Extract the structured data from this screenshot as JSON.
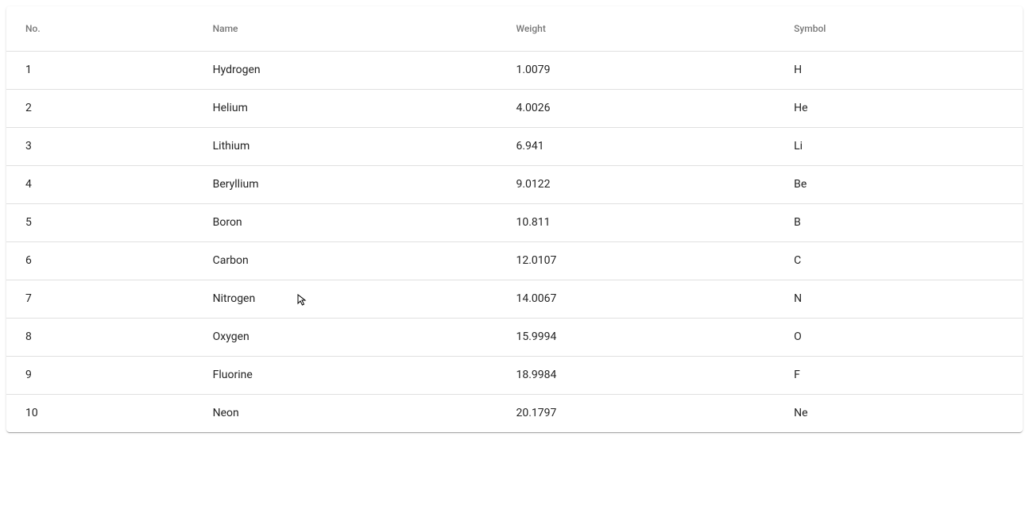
{
  "columns": {
    "no": "No.",
    "name": "Name",
    "weight": "Weight",
    "symbol": "Symbol"
  },
  "rows": [
    {
      "no": "1",
      "name": "Hydrogen",
      "weight": "1.0079",
      "symbol": "H"
    },
    {
      "no": "2",
      "name": "Helium",
      "weight": "4.0026",
      "symbol": "He"
    },
    {
      "no": "3",
      "name": "Lithium",
      "weight": "6.941",
      "symbol": "Li"
    },
    {
      "no": "4",
      "name": "Beryllium",
      "weight": "9.0122",
      "symbol": "Be"
    },
    {
      "no": "5",
      "name": "Boron",
      "weight": "10.811",
      "symbol": "B"
    },
    {
      "no": "6",
      "name": "Carbon",
      "weight": "12.0107",
      "symbol": "C"
    },
    {
      "no": "7",
      "name": "Nitrogen",
      "weight": "14.0067",
      "symbol": "N"
    },
    {
      "no": "8",
      "name": "Oxygen",
      "weight": "15.9994",
      "symbol": "O"
    },
    {
      "no": "9",
      "name": "Fluorine",
      "weight": "18.9984",
      "symbol": "F"
    },
    {
      "no": "10",
      "name": "Neon",
      "weight": "20.1797",
      "symbol": "Ne"
    }
  ]
}
